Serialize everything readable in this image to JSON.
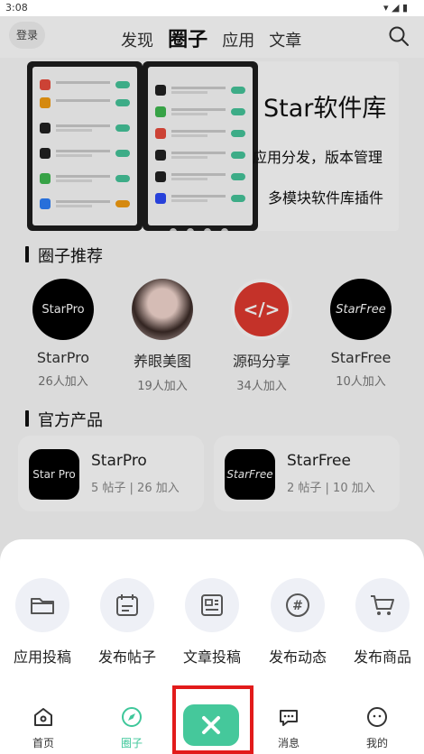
{
  "status": {
    "time": "3:08"
  },
  "header": {
    "login": "登录",
    "tabs": [
      {
        "label": "发现"
      },
      {
        "label": "圈子"
      },
      {
        "label": "应用"
      },
      {
        "label": "文章"
      }
    ]
  },
  "banner": {
    "title": "Star软件库",
    "subtitle1": "应用分发，版本管理",
    "subtitle2": "多模块软件库插件"
  },
  "circles": {
    "title": "圈子推荐",
    "items": [
      {
        "logo": "StarPro",
        "name": "StarPro",
        "count": "26人加入"
      },
      {
        "logo": "",
        "name": "养眼美图",
        "count": "19人加入"
      },
      {
        "logo": "</>",
        "name": "源码分享",
        "count": "34人加入"
      },
      {
        "logo": "StarFree",
        "name": "StarFree",
        "count": "10人加入"
      }
    ]
  },
  "products": {
    "title": "官方产品",
    "items": [
      {
        "logo": "Star Pro",
        "name": "StarPro",
        "meta": "5 帖子 | 26 加入"
      },
      {
        "logo": "StarFree",
        "name": "StarFree",
        "meta": "2 帖子 | 10 加入"
      }
    ]
  },
  "actions": [
    {
      "label": "应用投稿",
      "icon": "folder-icon"
    },
    {
      "label": "发布帖子",
      "icon": "calendar-icon"
    },
    {
      "label": "文章投稿",
      "icon": "article-icon"
    },
    {
      "label": "发布动态",
      "icon": "hashtag-icon"
    },
    {
      "label": "发布商品",
      "icon": "cart-icon"
    }
  ],
  "nav": {
    "items": [
      {
        "label": "首页"
      },
      {
        "label": "圈子"
      },
      {
        "label": "消息"
      },
      {
        "label": "我的"
      }
    ]
  },
  "colors": {
    "accent": "#45c89b",
    "highlight": "#e21b1b"
  }
}
